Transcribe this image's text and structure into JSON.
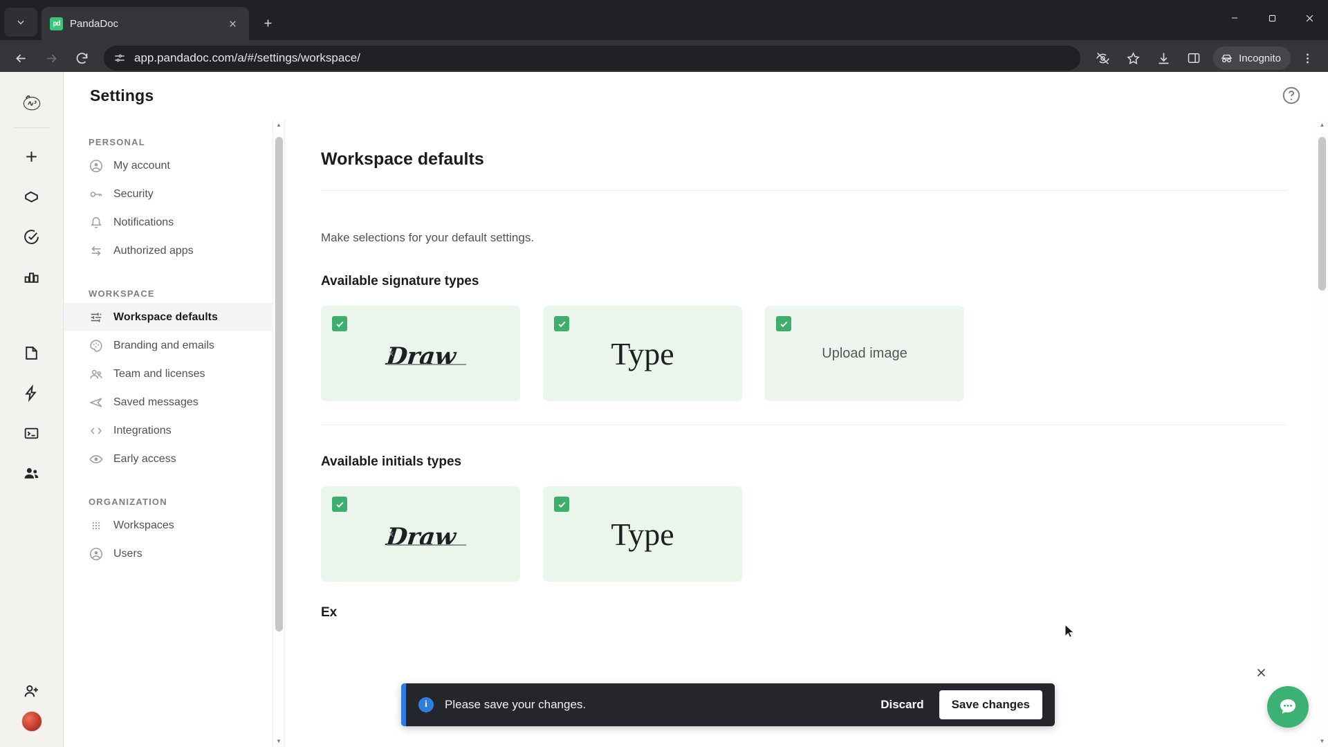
{
  "browser": {
    "tab": {
      "title": "PandaDoc",
      "favicon_label": "pd",
      "favicon_color": "#3bc47e"
    },
    "new_tab_label": "+",
    "tab_list_icon": "chevron-down-icon",
    "url": "app.pandadoc.com/a/#/settings/workspace/",
    "omnibox_icon": "site-settings-icon",
    "back_icon": "arrow-left-icon",
    "forward_icon": "arrow-right-icon",
    "reload_icon": "reload-icon",
    "tracking_icon": "eye-slash-icon",
    "bookmark_icon": "star-icon",
    "download_icon": "download-icon",
    "sidepanel_icon": "side-panel-icon",
    "incognito_label": "Incognito",
    "menu_icon": "three-dot-menu-icon",
    "window_minimize": "minimize-icon",
    "window_maximize": "maximize-icon",
    "window_close": "close-icon"
  },
  "rail": {
    "logo": "workspace-logo",
    "items": [
      {
        "name": "create-new-icon",
        "icon": "plus"
      },
      {
        "name": "home-icon",
        "icon": "pentagon"
      },
      {
        "name": "tasks-icon",
        "icon": "check-circle"
      },
      {
        "name": "reports-icon",
        "icon": "bar-chart"
      },
      {
        "name": "documents-icon",
        "icon": "document"
      },
      {
        "name": "automations-icon",
        "icon": "lightning"
      },
      {
        "name": "forms-icon",
        "icon": "terminal"
      },
      {
        "name": "contacts-icon",
        "icon": "people"
      },
      {
        "name": "invite-people-icon",
        "icon": "person-plus"
      }
    ],
    "avatar": "user-avatar"
  },
  "settings": {
    "header_title": "Settings",
    "help_icon": "help-circle-icon",
    "nav": {
      "groups": [
        {
          "label": "PERSONAL",
          "items": [
            {
              "label": "My account",
              "icon": "account-circle-icon",
              "active": false
            },
            {
              "label": "Security",
              "icon": "key-icon",
              "active": false
            },
            {
              "label": "Notifications",
              "icon": "bell-icon",
              "active": false
            },
            {
              "label": "Authorized apps",
              "icon": "transfer-arrows-icon",
              "active": false
            }
          ]
        },
        {
          "label": "WORKSPACE",
          "items": [
            {
              "label": "Workspace defaults",
              "icon": "sliders-icon",
              "active": true
            },
            {
              "label": "Branding and emails",
              "icon": "palette-icon",
              "active": false
            },
            {
              "label": "Team and licenses",
              "icon": "people-icon",
              "active": false
            },
            {
              "label": "Saved messages",
              "icon": "send-icon",
              "active": false
            },
            {
              "label": "Integrations",
              "icon": "code-brackets-icon",
              "active": false
            },
            {
              "label": "Early access",
              "icon": "eye-icon",
              "active": false
            }
          ]
        },
        {
          "label": "ORGANIZATION",
          "items": [
            {
              "label": "Workspaces",
              "icon": "grid-dots-icon",
              "active": false
            },
            {
              "label": "Users",
              "icon": "account-circle-icon",
              "active": false
            }
          ]
        }
      ]
    }
  },
  "main": {
    "page_title": "Workspace defaults",
    "lede": "Make selections for your default settings.",
    "signature_section": {
      "title": "Available signature types",
      "cards": [
        {
          "kind": "draw",
          "label": "Draw",
          "checked": true,
          "x_mark": "x"
        },
        {
          "kind": "type",
          "label": "Type",
          "checked": true
        },
        {
          "kind": "upload",
          "label": "Upload image",
          "checked": true
        }
      ]
    },
    "initials_section": {
      "title": "Available initials types",
      "cards": [
        {
          "kind": "draw",
          "label": "Draw",
          "checked": true,
          "x_mark": "x"
        },
        {
          "kind": "type",
          "label": "Type",
          "checked": true
        }
      ]
    },
    "next_section_partial_title": "Ex",
    "accent_green": "#3dae6b",
    "card_bg": "#eaf5ec"
  },
  "savebar": {
    "message": "Please save your changes.",
    "info_icon": "info-icon",
    "discard_label": "Discard",
    "save_label": "Save changes",
    "accent_color": "#2f7de1"
  },
  "chat": {
    "close_icon": "close-icon",
    "bubble_icon": "chat-bubble-icon",
    "bubble_color": "#3bb273"
  }
}
